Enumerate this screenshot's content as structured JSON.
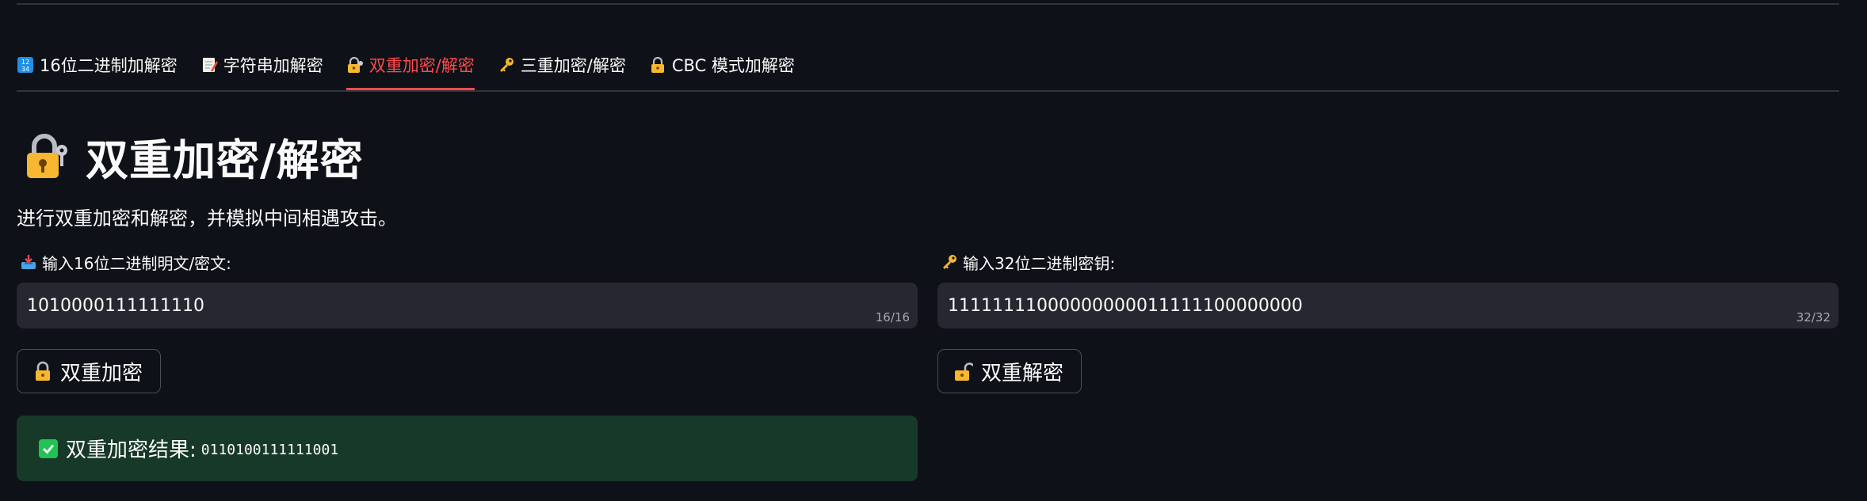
{
  "tabs": [
    {
      "label": "16位二进制加解密",
      "icon": "numbers-icon",
      "active": false
    },
    {
      "label": "字符串加解密",
      "icon": "memo-icon",
      "active": false
    },
    {
      "label": "双重加密/解密",
      "icon": "lock-with-key-icon",
      "active": true
    },
    {
      "label": "三重加密/解密",
      "icon": "key-icon",
      "active": false
    },
    {
      "label": "CBC 模式加解密",
      "icon": "lock-icon",
      "active": false
    }
  ],
  "header": {
    "title": "双重加密/解密",
    "title_icon": "lock-with-key-icon",
    "subtitle": "进行双重加密和解密，并模拟中间相遇攻击。"
  },
  "plaintext": {
    "label": "输入16位二进制明文/密文:",
    "icon": "inbox-tray-icon",
    "value": "1010000111111110",
    "counter": "16/16"
  },
  "key": {
    "label": "输入32位二进制密钥:",
    "icon": "key-icon",
    "value": "11111111000000000011111100000000",
    "counter": "32/32"
  },
  "buttons": {
    "encrypt": "双重加密",
    "decrypt": "双重解密"
  },
  "result": {
    "label": "双重加密结果:",
    "value": "0110100111111001"
  },
  "colors": {
    "background": "#0e1117",
    "accent": "#ff4b4b",
    "input_bg": "#262730",
    "success_bg": "#173928",
    "success_check": "#21c354"
  }
}
